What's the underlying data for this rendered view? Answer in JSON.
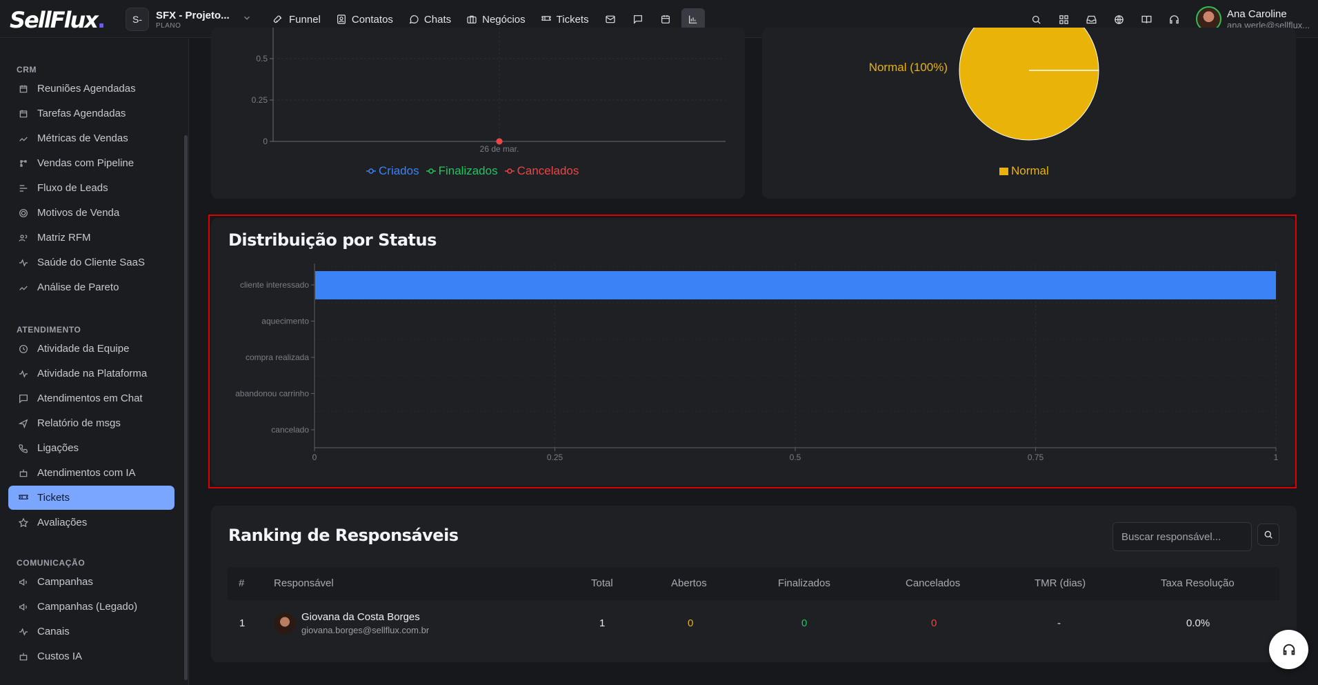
{
  "header": {
    "logo": "SellFlux",
    "logo_dot": ".",
    "project_badge": "S-",
    "project_name": "SFX - Projeto...",
    "project_plan": "PLANO",
    "nav": [
      {
        "label": "Funnel",
        "icon": "rocket-icon"
      },
      {
        "label": "Contatos",
        "icon": "contacts-icon"
      },
      {
        "label": "Chats",
        "icon": "chat-icon"
      },
      {
        "label": "Negócios",
        "icon": "briefcase-icon"
      },
      {
        "label": "Tickets",
        "icon": "ticket-icon"
      }
    ],
    "user_name": "Ana Caroline",
    "user_email": "ana.werle@sellflux..."
  },
  "sidebar": {
    "sections": [
      {
        "title": "CRM",
        "items": [
          "Reuniões Agendadas",
          "Tarefas Agendadas",
          "Métricas de Vendas",
          "Vendas com Pipeline",
          "Fluxo de Leads",
          "Motivos de Venda",
          "Matriz RFM",
          "Saúde do Cliente SaaS",
          "Análise de Pareto"
        ]
      },
      {
        "title": "ATENDIMENTO",
        "items": [
          "Atividade da Equipe",
          "Atividade na Plataforma",
          "Atendimentos em Chat",
          "Relatório de msgs",
          "Ligações",
          "Atendimentos com IA",
          "Tickets",
          "Avaliações"
        ]
      },
      {
        "title": "COMUNICAÇÃO",
        "items": [
          "Campanhas",
          "Campanhas (Legado)",
          "Canais",
          "Custos IA"
        ]
      }
    ],
    "active": "Tickets"
  },
  "line_card": {
    "chart_data": {
      "type": "line",
      "x": [
        "26 de mar."
      ],
      "yticks": [
        "0",
        "0.25",
        "0.5"
      ],
      "series": [
        {
          "name": "Criados",
          "values": [
            0
          ],
          "color": "#3b82f6"
        },
        {
          "name": "Finalizados",
          "values": [
            0
          ],
          "color": "#22c55e"
        },
        {
          "name": "Cancelados",
          "values": [
            0
          ],
          "color": "#ef4444"
        }
      ]
    }
  },
  "pie_card": {
    "chart_data": {
      "type": "pie",
      "slices": [
        {
          "name": "Normal",
          "value": 100,
          "color": "#eab308"
        }
      ],
      "slice_label": "Normal (100%)",
      "legend": [
        "Normal"
      ]
    }
  },
  "status_card": {
    "title": "Distribuição por Status",
    "chart_data": {
      "type": "bar",
      "orientation": "horizontal",
      "categories": [
        "cliente interessado",
        "aquecimento",
        "compra realizada",
        "abandonou carrinho",
        "cancelado"
      ],
      "values": [
        1,
        0,
        0,
        0,
        0
      ],
      "xlim": [
        0,
        1
      ],
      "xticks": [
        "0",
        "0.25",
        "0.5",
        "0.75",
        "1"
      ],
      "color": "#3b82f6"
    }
  },
  "ranking": {
    "title": "Ranking de Responsáveis",
    "search_placeholder": "Buscar responsável...",
    "columns": [
      "#",
      "Responsável",
      "Total",
      "Abertos",
      "Finalizados",
      "Cancelados",
      "TMR (dias)",
      "Taxa Resolução"
    ],
    "rows": [
      {
        "rank": "1",
        "name": "Giovana da Costa Borges",
        "email": "giovana.borges@sellflux.com.br",
        "total": "1",
        "abertos": "0",
        "finalizados": "0",
        "cancelados": "0",
        "tmr": "-",
        "taxa": "0.0%"
      }
    ]
  },
  "colors": {
    "abertos": "#eab308",
    "finalizados": "#22c55e",
    "cancelados": "#ef4444",
    "accent": "#7ba6ff"
  }
}
